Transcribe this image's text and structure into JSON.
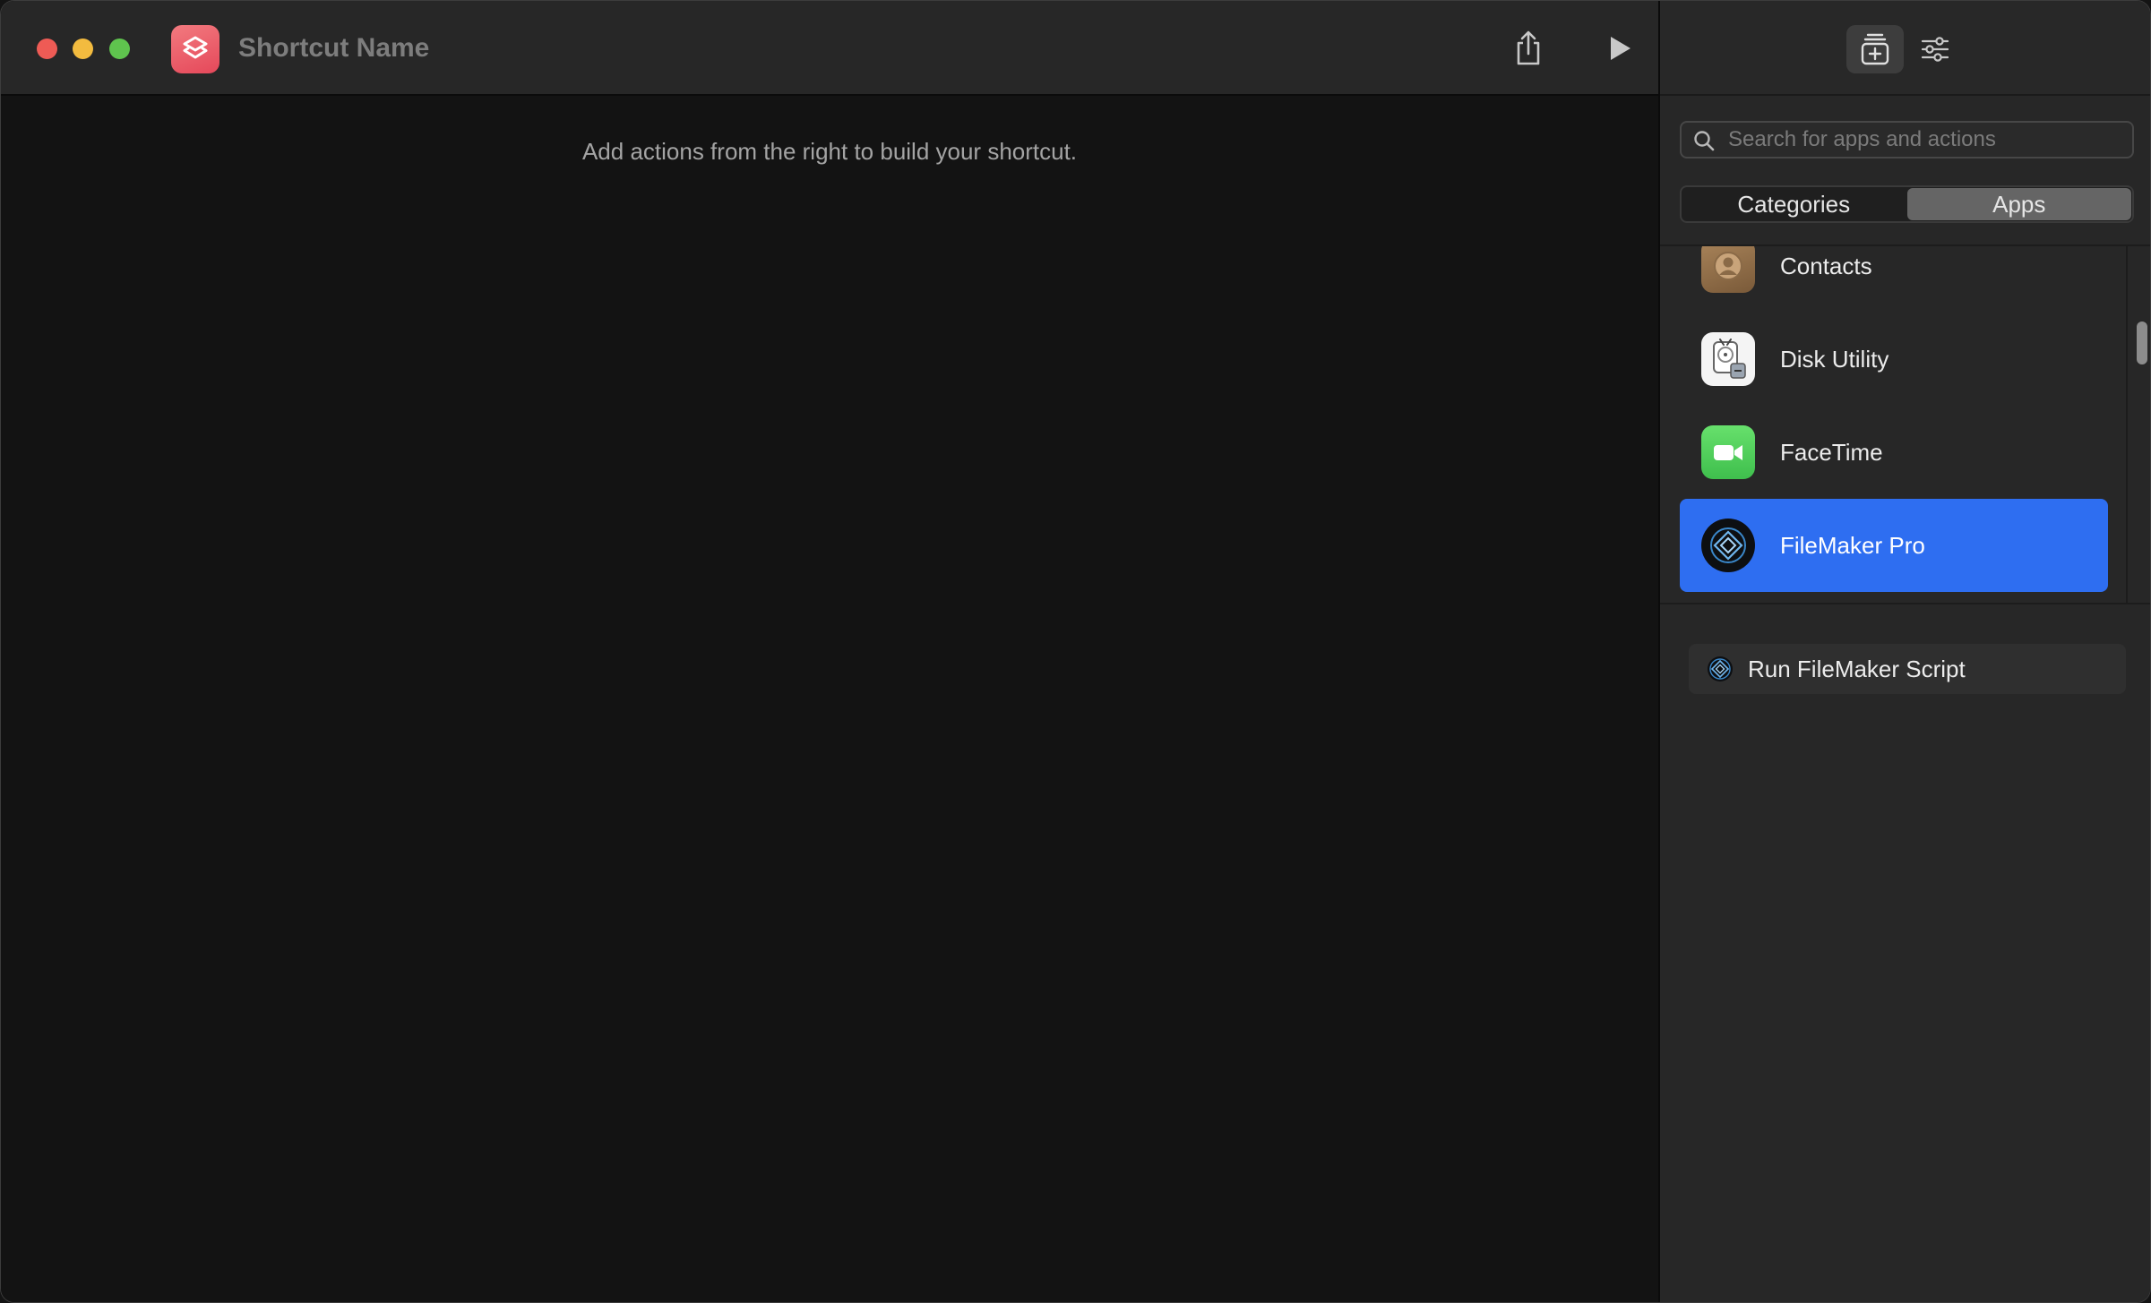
{
  "window": {
    "shortcut_name": "Shortcut Name",
    "placeholder_text": "Add actions from the right to build your shortcut."
  },
  "toolbar": {
    "icons": {
      "share": "share-icon",
      "run": "play-icon",
      "library": "action-library-icon",
      "details": "sliders-icon"
    }
  },
  "sidebar": {
    "search": {
      "placeholder": "Search for apps and actions",
      "value": ""
    },
    "segments": [
      {
        "label": "Categories",
        "selected": false
      },
      {
        "label": "Apps",
        "selected": true
      }
    ],
    "apps": [
      {
        "label": "Contacts",
        "icon": "contacts-icon",
        "selected": false
      },
      {
        "label": "Disk Utility",
        "icon": "disk-utility-icon",
        "selected": false
      },
      {
        "label": "FaceTime",
        "icon": "facetime-icon",
        "selected": false
      },
      {
        "label": "FileMaker Pro",
        "icon": "filemaker-icon",
        "selected": true
      }
    ],
    "actions": [
      {
        "label": "Run FileMaker Script",
        "icon": "filemaker-icon"
      }
    ]
  },
  "colors": {
    "selection": "#2e6ef1",
    "traffic_close": "#ee5b55",
    "traffic_minimize": "#f3bb3f",
    "traffic_zoom": "#5fc44e",
    "shortcuts_icon": "#e5485a",
    "facetime_green": "#4fcf5b"
  }
}
